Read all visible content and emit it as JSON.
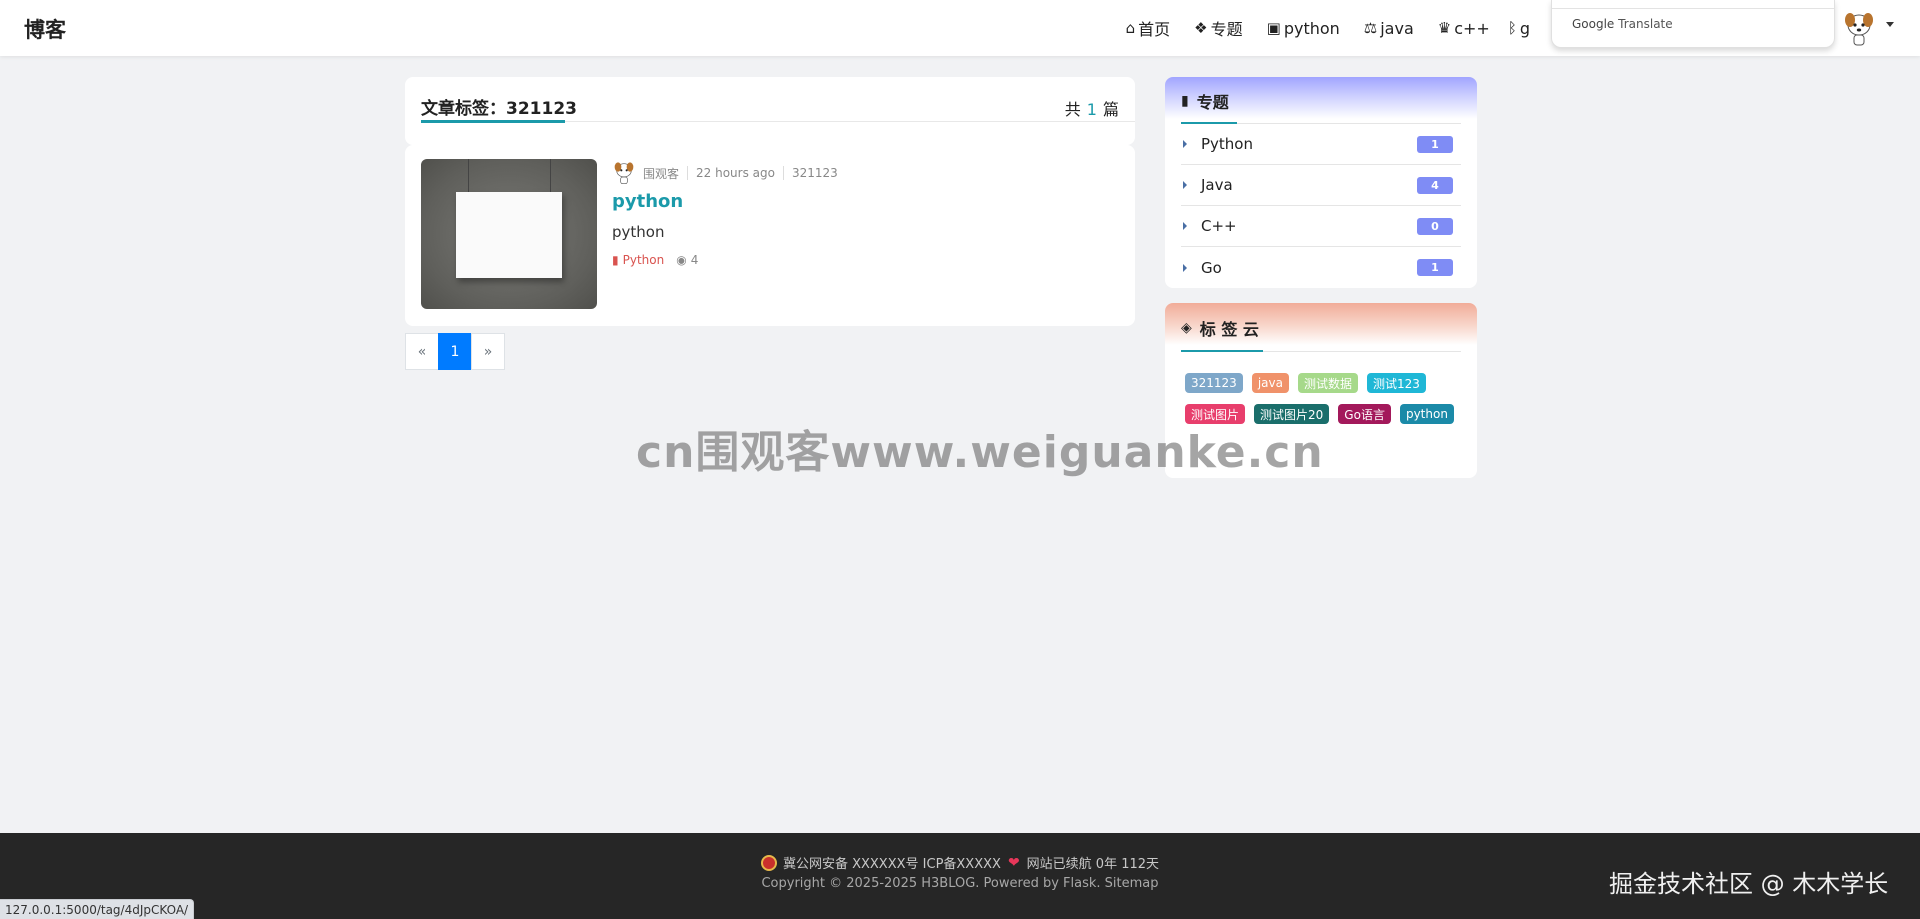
{
  "navbar": {
    "brand": "博客",
    "items": [
      {
        "label": "首页",
        "icon": "home-icon",
        "glyph": "⌂"
      },
      {
        "label": "专题",
        "icon": "cubes-icon",
        "glyph": "❖"
      },
      {
        "label": "python",
        "icon": "python-icon",
        "glyph": "▣"
      },
      {
        "label": "java",
        "icon": "balance-scale-icon",
        "glyph": "⚖"
      },
      {
        "label": "c++",
        "icon": "fence-icon",
        "glyph": "♛"
      },
      {
        "label": "g",
        "icon": "bluetooth-icon",
        "glyph": "ᛒ"
      }
    ],
    "translate_popup": {
      "brand": "Google",
      "label": "Translate"
    }
  },
  "tag_header": {
    "title": "文章标签：321123",
    "count_prefix": "共",
    "count": "1",
    "count_suffix": "篇"
  },
  "post": {
    "author": "围观客",
    "time": "22 hours ago",
    "tag": "321123",
    "title": "python",
    "summary": "python",
    "topic": "Python",
    "views": "4"
  },
  "pagination": {
    "prev": "«",
    "current": "1",
    "next": "»"
  },
  "sidebar": {
    "topics_title": "专题",
    "topics": [
      {
        "name": "Python",
        "count": "1"
      },
      {
        "name": "Java",
        "count": "4"
      },
      {
        "name": "C++",
        "count": "0"
      },
      {
        "name": "Go",
        "count": "1"
      }
    ],
    "tags_title": "标 签 云",
    "tags": [
      {
        "label": "321123",
        "color": "#7ea7c9"
      },
      {
        "label": "java",
        "color": "#f0926a"
      },
      {
        "label": "测试数据",
        "color": "#a6d98a"
      },
      {
        "label": "测试123",
        "color": "#1fb7d6"
      },
      {
        "label": "测试图片",
        "color": "#e83e6c"
      },
      {
        "label": "测试图片20",
        "color": "#1a6e6b"
      },
      {
        "label": "Go语言",
        "color": "#a3195b"
      },
      {
        "label": "python",
        "color": "#1b8aa8"
      }
    ]
  },
  "watermark": "cn围观客www.weiguanke.cn",
  "footer": {
    "beian": "冀公网安备 XXXXXX号 ICP备XXXXX",
    "heart": "❤",
    "uptime": "网站已续航 0年 112天",
    "copyright": "Copyright © 2025-2025 H3BLOG. Powered by Flask. Sitemap",
    "juejin": "掘金技术社区 @ 木木学长"
  },
  "status_url": "127.0.0.1:5000/tag/4dJpCKOA/"
}
